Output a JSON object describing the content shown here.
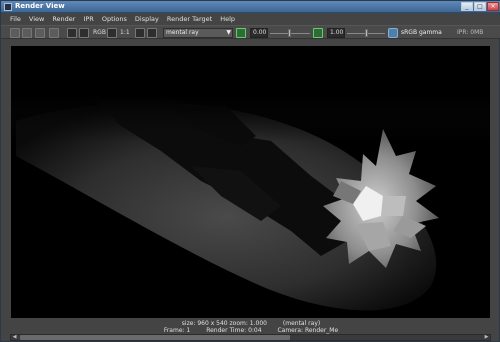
{
  "window": {
    "title": "Render View"
  },
  "menu": [
    "File",
    "View",
    "Render",
    "IPR",
    "Options",
    "Display",
    "Render Target",
    "Help"
  ],
  "toolbar": {
    "rgb_label": "RGB",
    "ratio_label": "1:1",
    "renderer": "mental ray",
    "exposure_value": "0.00",
    "gamma_value": "1.00",
    "color_management": "sRGB gamma",
    "ipr_memory": "IPR: 0MB"
  },
  "viewport": {
    "size_info": "size: 960 x 540 zoom: 1.000",
    "renderer_info": "(mental ray)",
    "frame": "Frame: 1",
    "render_time": "Render Time: 0:04",
    "camera": "Camera: Render_Me"
  }
}
